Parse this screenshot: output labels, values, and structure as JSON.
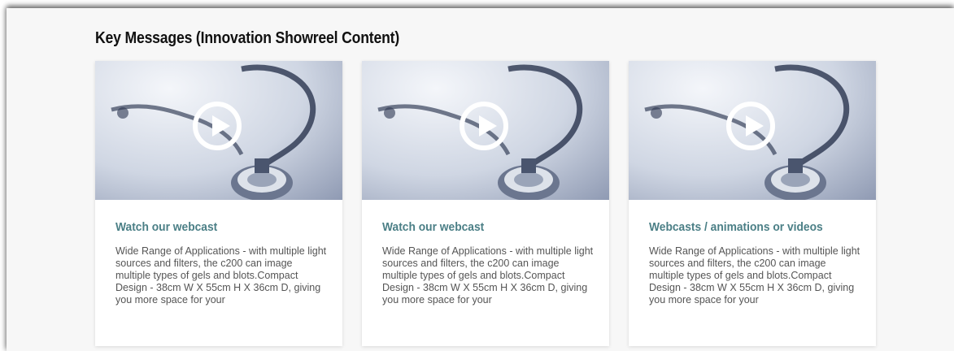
{
  "section": {
    "title": "Key Messages (Innovation Showreel Content)"
  },
  "cards": [
    {
      "title": "Watch our webcast",
      "description": "Wide Range of Applications - with multiple light sources and filters, the c200 can image multiple types of gels and blots.Compact Design - 38cm W X 55cm H X 36cm D, giving you more space for your",
      "image": "stethoscope-photo"
    },
    {
      "title": "Watch our webcast",
      "description": "Wide Range of Applications - with multiple light sources and filters, the c200 can image multiple types of gels and blots.Compact Design - 38cm W X 55cm H X 36cm D, giving you more space for your",
      "image": "stethoscope-photo"
    },
    {
      "title": "Webcasts / animations or videos",
      "description": "Wide Range of Applications - with multiple light sources and filters, the c200 can image multiple types of gels and blots.Compact Design - 38cm W X 55cm H X 36cm D, giving you more space for your",
      "image": "stethoscope-photo"
    }
  ],
  "colors": {
    "accent": "#4b7f86",
    "panel_background": "#f7f7f7",
    "card_background": "#ffffff"
  }
}
